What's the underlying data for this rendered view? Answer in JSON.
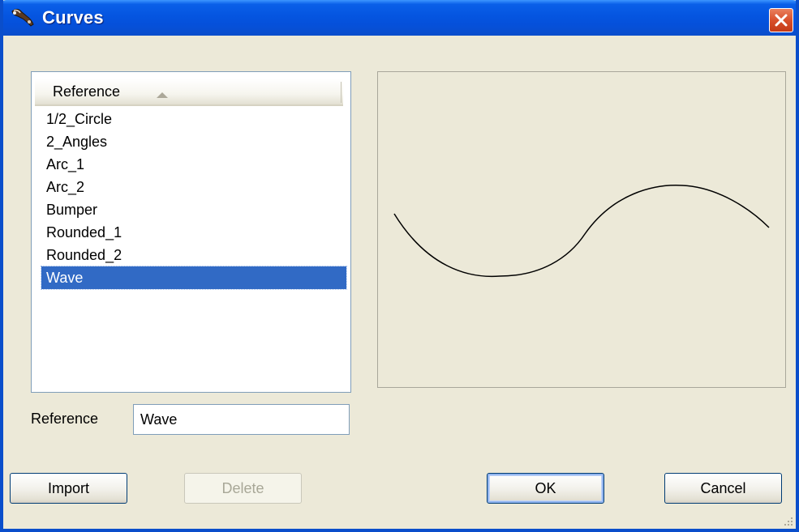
{
  "window": {
    "title": "Curves"
  },
  "list": {
    "column_header": "Reference",
    "sort": "ascending",
    "items": [
      "1/2_Circle",
      "2_Angles",
      "Arc_1",
      "Arc_2",
      "Bumper",
      "Rounded_1",
      "Rounded_2",
      "Wave"
    ],
    "selected_item": "Wave"
  },
  "reference_field": {
    "label": "Reference",
    "value": "Wave"
  },
  "buttons": {
    "import": "Import",
    "delete": "Delete",
    "ok": "OK",
    "cancel": "Cancel"
  },
  "colors": {
    "titlebar": "#0A4ECB",
    "dialog_background": "#ECE9D8",
    "selection": "#316AC5",
    "close_button": "#D9502C"
  },
  "icons": {
    "app": "curves-app-icon",
    "close": "close-icon",
    "sort": "sort-ascending-icon",
    "resize": "resize-grip-icon"
  }
}
